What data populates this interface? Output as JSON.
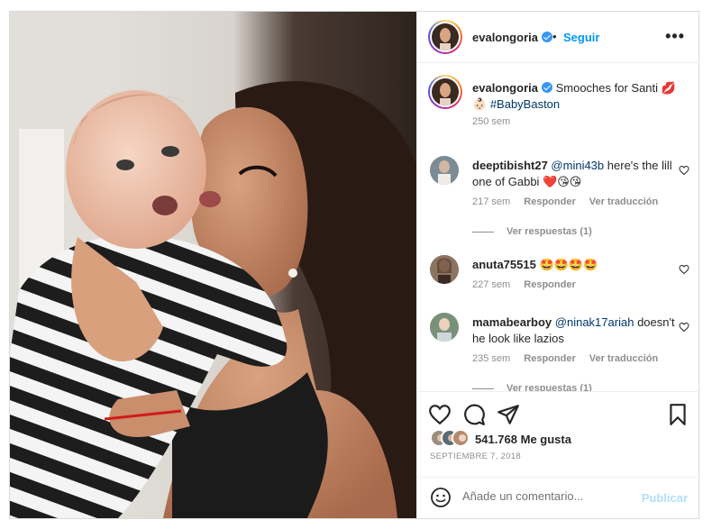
{
  "post": {
    "photo_alt": "",
    "author": {
      "username": "evalongoria",
      "verified": true,
      "follow_label": "Seguir",
      "separator": "•"
    },
    "more_label": "•••"
  },
  "caption": {
    "username": "evalongoria",
    "text": "Smooches for Santi 💋",
    "emoji": "👶🏻",
    "hashtag": "#BabyBaston",
    "time": "250 sem"
  },
  "comments": [
    {
      "username": "deeptibisht27",
      "mention": "@mini43b",
      "text": "here's the lill one of Gabbi ❤️😘😘",
      "time": "217 sem",
      "reply_label": "Responder",
      "translate_label": "Ver traducción",
      "replies_label": "Ver respuestas (1)"
    },
    {
      "username": "anuta75515",
      "text": "🤩🤩🤩🤩",
      "time": "227 sem",
      "reply_label": "Responder"
    },
    {
      "username": "mamabearboy",
      "mention": "@ninak17ariah",
      "text": "doesn't he look like lazios",
      "time": "235 sem",
      "reply_label": "Responder",
      "translate_label": "Ver traducción",
      "replies_label": "Ver respuestas (1)"
    }
  ],
  "actions": {
    "likes_count": "541.768",
    "likes_label": "Me gusta",
    "date": "SEPTIEMBRE 7, 2018"
  },
  "add_comment": {
    "placeholder": "Añade un comentario...",
    "publish_label": "Publicar"
  },
  "icons": {
    "like": "heart-icon",
    "comment": "comment-bubble-icon",
    "share": "paper-plane-icon",
    "save": "bookmark-icon",
    "emoji": "smiley-icon",
    "verified": "verified-badge-icon",
    "more": "more-options-icon"
  },
  "colors": {
    "link_blue": "#0095f6",
    "verified_blue": "#3897f0",
    "secondary_text": "#8e8e8e",
    "border": "#dbdbdb",
    "publish_disabled": "#b2dffc",
    "heart_red": "#ed4956"
  }
}
